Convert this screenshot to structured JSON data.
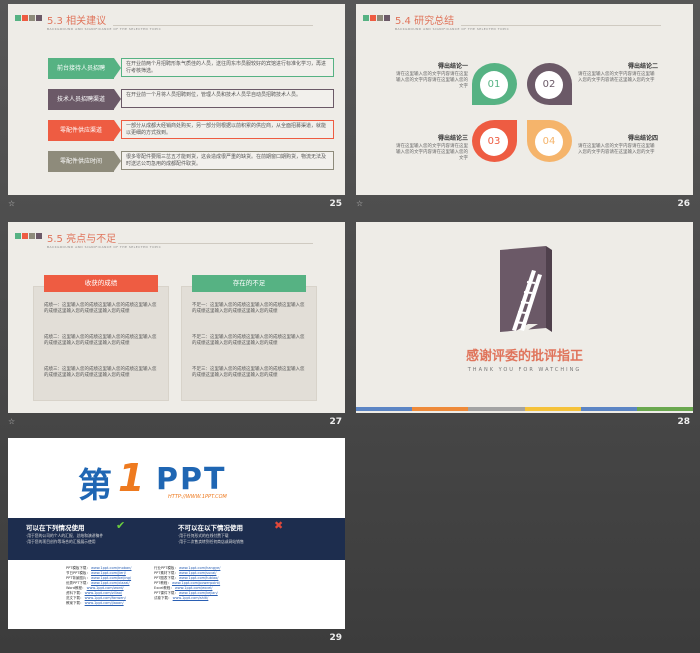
{
  "slides": [
    {
      "number": "25",
      "title": "5.3 相关建议",
      "subtitle": "BACKGROUND AND SIGNIFICANCE OF THE SELECTED TOPIC"
    },
    {
      "number": "26",
      "title": "5.4 研究总结",
      "subtitle": "BACKGROUND AND SIGNIFICANCE OF THE SELECTED TOPIC"
    },
    {
      "number": "27",
      "title": "5.5 亮点与不足",
      "subtitle": "BACKGROUND AND SIGNIFICANCE OF THE SELECTED TOPIC"
    },
    {
      "number": "28"
    },
    {
      "number": "29"
    }
  ],
  "s25_rows": [
    {
      "label": "前台接待人员招聘",
      "text": "在开业前两个月招聘形象气质佳的人员，送往周东市员服较好的宾馆进行标准化学习，再进行考核筛选。",
      "color": "#56b283"
    },
    {
      "label": "技术人员招聘渠道",
      "text": "在开业前一个月将人员招聘到位，管理人员和技术人员早自动员招聘技术人员。",
      "color": "#6b5967"
    },
    {
      "label": "零配件供应渠道",
      "text": "一部分从成都大经销商处购买，另一部分则根据以前积累的供应商，从全面招募渠道，就能以更细的方式找到。",
      "color": "#ee5c42"
    },
    {
      "label": "零配件供应时间",
      "text": "很多零配件要隔三岔五才能到货，这会造成很严重的缺货。在前期窗口期购货，物流无法及时送达公司急用的成都配件取货。",
      "color": "#8e8b7b"
    }
  ],
  "s26": {
    "items": [
      {
        "num": "01",
        "color": "#56b283"
      },
      {
        "num": "02",
        "color": "#6b5967"
      },
      {
        "num": "03",
        "color": "#ee5c42"
      },
      {
        "num": "04",
        "color": "#f5b46b"
      }
    ],
    "blocks": [
      {
        "head": "得出结论一",
        "text": "请在这里输入您的文字内容请在这里输入您的文字内容请在这里输入您的文字"
      },
      {
        "head": "得出结论二",
        "text": "请在这里输入您的文字内容请在这里输入您的文字内容请在这里输入您的文字"
      },
      {
        "head": "得出结论三",
        "text": "请在这里输入您的文字内容请在这里输入您的文字内容请在这里输入您的文字"
      },
      {
        "head": "得出结论四",
        "text": "请在这里输入您的文字内容请在这里输入您的文字内容请在这里输入您的文字"
      }
    ]
  },
  "s27": {
    "left_title": "收获的成绩",
    "right_title": "存在的不足",
    "left": [
      "成绩一：这里输入您的成绩这里输入您的成绩这里输入您的成绩这里输入您的成绩这里输入您的成绩",
      "成绩二：这里输入您的成绩这里输入您的成绩这里输入您的成绩这里输入您的成绩这里输入您的成绩",
      "成绩三：这里输入您的成绩这里输入您的成绩这里输入您的成绩这里输入您的成绩这里输入您的成绩"
    ],
    "right": [
      "不足一：这里输入您的成绩这里输入您的成绩这里输入您的成绩这里输入您的成绩这里输入您的成绩",
      "不足二：这里输入您的成绩这里输入您的成绩这里输入您的成绩这里输入您的成绩这里输入您的成绩",
      "不足三：这里输入您的成绩这里输入您的成绩这里输入您的成绩这里输入您的成绩这里输入您的成绩"
    ]
  },
  "s28": {
    "title": "感谢评委的批评指正",
    "subtitle": "THANK YOU FOR WATCHING"
  },
  "s29": {
    "logo_a": "第",
    "logo_b": "1",
    "logo_c": "PPT",
    "logo_url": "HTTP://WWW.1PPT.COM",
    "can_title": "可以在下列情况使用",
    "can_items": [
      "·用于您的公司的个人的汇报、总结和演讲稿件",
      "·用于您的项目创作等场合的汇报展示使用"
    ],
    "cannot_title": "不可以在以下情况使用",
    "cannot_items": [
      "·用于任何形式的在线付费下载",
      "·用于二次售卖转到任何商店或网站销售"
    ],
    "links_left": [
      {
        "k": "PPT模板下载：",
        "v": "www.1ppt.com/moban/"
      },
      {
        "k": "节日PPT模板：",
        "v": "www.1ppt.com/jieri/"
      },
      {
        "k": "PPT背景图片：",
        "v": "www.1ppt.com/beijing/"
      },
      {
        "k": "优秀PPT下载：",
        "v": "www.1ppt.com/xiazai/"
      },
      {
        "k": "Word教程：",
        "v": "www.1ppt.com/word/"
      },
      {
        "k": "资料下载：",
        "v": "www.1ppt.com/ziliao/"
      },
      {
        "k": "范文下载：",
        "v": "www.1ppt.com/fanwen/"
      },
      {
        "k": "教案下载：",
        "v": "www.1ppt.com/jiaoan/"
      }
    ],
    "links_right": [
      {
        "k": "行业PPT模板：",
        "v": "www.1ppt.com/hangye/"
      },
      {
        "k": "PPT素材下载：",
        "v": "www.1ppt.com/sucai/"
      },
      {
        "k": "PPT图表下载：",
        "v": "www.1ppt.com/tubiao/"
      },
      {
        "k": "PPT教程：",
        "v": "www.1ppt.com/powerpoint/"
      },
      {
        "k": "Excel教程：",
        "v": "www.1ppt.com/excel/"
      },
      {
        "k": "PPT课件下载：",
        "v": "www.1ppt.com/kejian/"
      },
      {
        "k": "试卷下载：",
        "v": "www.1ppt.com/shiti/"
      }
    ]
  },
  "colors": {
    "green": "#56b283",
    "purple": "#6b5967",
    "red": "#ee5c42",
    "orange": "#f5b46b",
    "gray": "#8e8b7b",
    "navy": "#1d2d4e"
  }
}
